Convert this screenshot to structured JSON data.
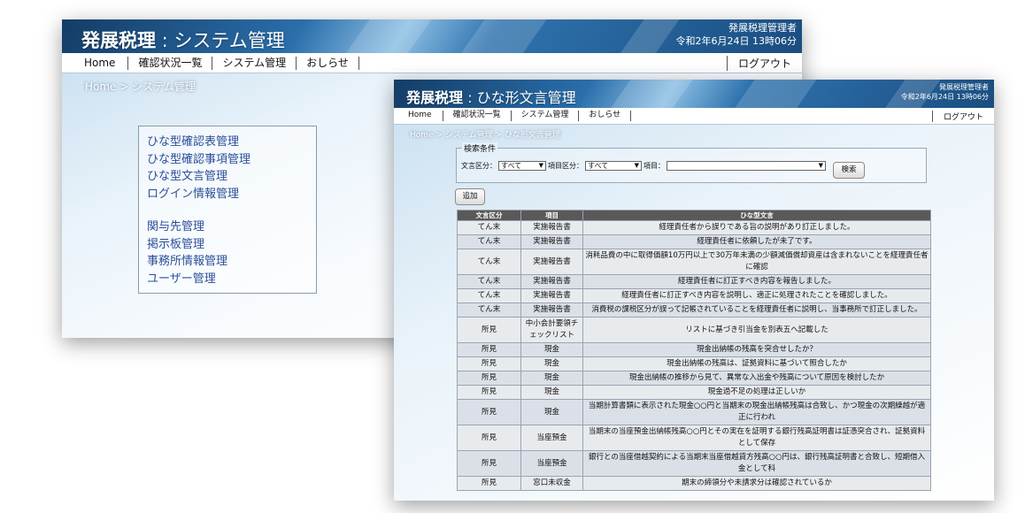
{
  "app": {
    "name": "発展税理"
  },
  "back_window": {
    "title_suffix": "システム管理",
    "user": "発展税理管理者",
    "datetime": "令和2年6月24日 13時06分",
    "nav": [
      "Home",
      "確認状況一覧",
      "システム管理",
      "おしらせ"
    ],
    "logout": "ログアウト",
    "breadcrumb": "Home > システム管理",
    "menu_group_1": [
      "ひな型確認表管理",
      "ひな型確認事項管理",
      "ひな型文言管理",
      "ログイン情報管理"
    ],
    "menu_group_2": [
      "関与先管理",
      "掲示板管理",
      "事務所情報管理",
      "ユーザー管理"
    ]
  },
  "front_window": {
    "title_suffix": "ひな形文言管理",
    "user": "発展税理管理者",
    "datetime": "令和2年6月24日 13時06分",
    "nav": [
      "Home",
      "確認状況一覧",
      "システム管理",
      "おしらせ"
    ],
    "logout": "ログアウト",
    "breadcrumb": "Home > システム管理 > ひな形文言管理",
    "search": {
      "legend": "検索条件",
      "doc_type_label": "文言区分：",
      "doc_type_value": "すべて",
      "item_type_label": "項目区分：",
      "item_type_value": "すべて",
      "item_label": "項目：",
      "item_value": "",
      "button": "検索"
    },
    "add_button": "追加",
    "table": {
      "headers": [
        "文言区分",
        "項目",
        "ひな型文言"
      ],
      "rows": [
        [
          "てん末",
          "実施報告書",
          "経理責任者から誤りである旨の説明があり訂正しました。"
        ],
        [
          "てん末",
          "実施報告書",
          "経理責任者に依頼したが未了です。"
        ],
        [
          "てん末",
          "実施報告書",
          "消耗品費の中に取得価額10万円以上で30万年未満の少額減価償却資産は含まれないことを経理責任者に確認"
        ],
        [
          "てん末",
          "実施報告書",
          "経理責任者に訂正すべき内容を報告しました。"
        ],
        [
          "てん末",
          "実施報告書",
          "経理責任者に訂正すべき内容を説明し、適正に処理されたことを確認しました。"
        ],
        [
          "てん末",
          "実施報告書",
          "消費税の課税区分が誤って記帳されていることを経理責任者に説明し、当事務所で訂正しました。"
        ],
        [
          "所見",
          "中小会計要領チェックリスト",
          "リストに基づき引当金を別表五へ記載した"
        ],
        [
          "所見",
          "現金",
          "現金出納帳の残高を突合せしたか？"
        ],
        [
          "所見",
          "現金",
          "現金出納帳の残高は、証拠資料に基づいて照合したか"
        ],
        [
          "所見",
          "現金",
          "現金出納帳の推移から見て、異常な入出金や残高について原因を検討したか"
        ],
        [
          "所見",
          "現金",
          "現金過不足の処理は正しいか"
        ],
        [
          "所見",
          "現金",
          "当期計算書類に表示された現金○○円と当期末の現金出納帳残高は合致し、かつ現金の次期繰越が適正に行われ"
        ],
        [
          "所見",
          "当座預金",
          "当期末の当座預金出納帳残高○○円とその実在を証明する銀行残高証明書は証憑突合され、証拠資料として保存"
        ],
        [
          "所見",
          "当座預金",
          "銀行との当座借越契約による当期末当座借越貸方残高○○円は、銀行残高証明書と合致し、短期借入金として科"
        ],
        [
          "所見",
          "窓口未収金",
          "期末の締領分や未請求分は確認されているか"
        ]
      ]
    }
  }
}
